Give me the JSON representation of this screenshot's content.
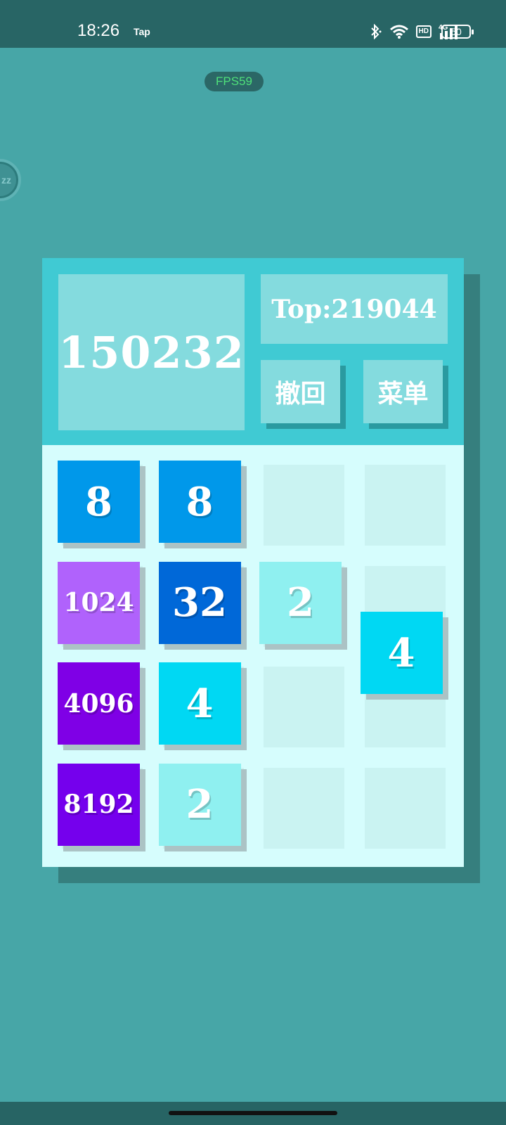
{
  "status_bar": {
    "time": "18:26",
    "app_tag": "Tap",
    "icons": [
      "bluetooth-icon",
      "wifi-icon",
      "hd-icon",
      "4g-signal-icon"
    ],
    "hd_label": "HD",
    "network_label": "4G",
    "battery": "50"
  },
  "fps_label": "FPS59",
  "floating_bubble_text": "zz",
  "game": {
    "score": "150232",
    "best": "Top:219044",
    "undo_label": "撤回",
    "menu_label": "菜单",
    "tiles": [
      {
        "value": "8",
        "row": 0,
        "col": 0,
        "color": "#0098ea"
      },
      {
        "value": "8",
        "row": 0,
        "col": 1,
        "color": "#0098ea"
      },
      {
        "value": "1024",
        "row": 1,
        "col": 0,
        "color": "#b062fc"
      },
      {
        "value": "32",
        "row": 1,
        "col": 1,
        "color": "#0068d8"
      },
      {
        "value": "2",
        "row": 1,
        "col": 2,
        "color": "#8ff0f0"
      },
      {
        "value": "4",
        "row": 1.5,
        "col": 3,
        "color": "#00d8f3"
      },
      {
        "value": "4096",
        "row": 2,
        "col": 0,
        "color": "#7f00e6"
      },
      {
        "value": "4",
        "row": 2,
        "col": 1,
        "color": "#00d8f3"
      },
      {
        "value": "8192",
        "row": 3,
        "col": 0,
        "color": "#7500ed"
      },
      {
        "value": "2",
        "row": 3,
        "col": 1,
        "color": "#8ff0f0"
      }
    ]
  },
  "colors": {
    "background": "#47a6a7",
    "header": "#40cad3",
    "board": "#d6fdfd",
    "empty_cell": "#caf3f2"
  }
}
